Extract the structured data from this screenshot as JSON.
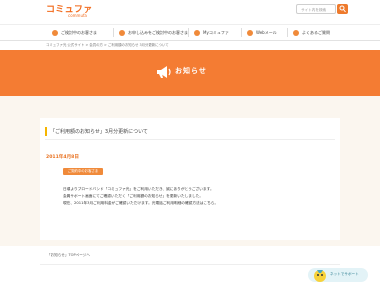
{
  "brand": {
    "logo_main": "コミュファ",
    "logo_sub": "commufa"
  },
  "search": {
    "placeholder": "サイト内を検索"
  },
  "nav": {
    "items": [
      {
        "label": "ご検討中のお客さま"
      },
      {
        "label": "お申し込みをご検討中のお客さま"
      },
      {
        "label": "Myコミュファ"
      },
      {
        "label": "Webメール"
      },
      {
        "label": "よくあるご質問"
      }
    ]
  },
  "breadcrumb": "コミュファ光 公式サイト > 会員の方 > ご利用額のお知らせ 3月分更新について",
  "hero": {
    "title": "お知らせ"
  },
  "article": {
    "headline": "「ご利用額のお知らせ」3月分更新について",
    "date": "2011年4月8日",
    "tag": "ご契約中のお客さま",
    "body": [
      "日頃よりブロードバンド「コミュファ光」をご利用いただき、誠にありがとうございます。",
      "会員サポート画面にてご確認いただく「ご利用額のお知らせ」を更新いたしました。",
      "現在、2011年3月ご利用料金がご確認いただけます。光電話ご利用明細の確認方法はこちら。"
    ]
  },
  "footer": {
    "link": "「お知らせ」TOPページへ"
  },
  "support": {
    "label": "ネットでサポート"
  },
  "colors": {
    "accent": "#f47c33",
    "headline_bar": "#f5b500",
    "date": "#e87120"
  }
}
